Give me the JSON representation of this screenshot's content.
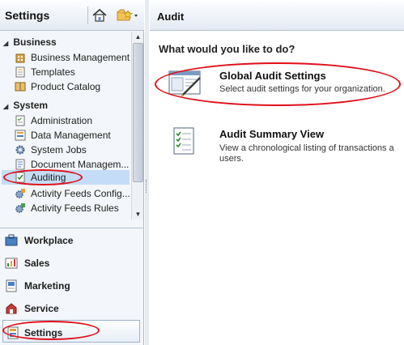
{
  "left_panel": {
    "title": "Settings",
    "home_icon": "home-icon",
    "favorites_icon": "star-folder-icon",
    "groups": [
      {
        "label": "Business",
        "items": [
          {
            "label": "Business Management",
            "icon": "building-icon"
          },
          {
            "label": "Templates",
            "icon": "templates-icon"
          },
          {
            "label": "Product Catalog",
            "icon": "catalog-icon"
          }
        ]
      },
      {
        "label": "System",
        "items": [
          {
            "label": "Administration",
            "icon": "administration-icon"
          },
          {
            "label": "Data Management",
            "icon": "data-management-icon"
          },
          {
            "label": "System Jobs",
            "icon": "gear-icon"
          },
          {
            "label": "Document Managem...",
            "icon": "document-management-icon"
          },
          {
            "label": "Auditing",
            "icon": "auditing-icon",
            "selected": true
          },
          {
            "label": "Activity Feeds Config...",
            "icon": "activity-feeds-config-icon"
          },
          {
            "label": "Activity Feeds Rules",
            "icon": "activity-feeds-rules-icon"
          }
        ]
      }
    ],
    "nav_buttons": [
      {
        "label": "Workplace",
        "icon": "workplace-icon"
      },
      {
        "label": "Sales",
        "icon": "sales-icon"
      },
      {
        "label": "Marketing",
        "icon": "marketing-icon"
      },
      {
        "label": "Service",
        "icon": "service-icon"
      },
      {
        "label": "Settings",
        "icon": "settings-icon",
        "active": true
      }
    ]
  },
  "main": {
    "title": "Audit",
    "prompt": "What would you like to do?",
    "options": [
      {
        "title": "Global Audit Settings",
        "description": "Select audit settings for your organization.",
        "icon": "global-audit-settings-icon"
      },
      {
        "title": "Audit Summary View",
        "description_line1": "View a chronological listing of transactions a",
        "description_line2": "users.",
        "icon": "audit-summary-view-icon"
      }
    ]
  },
  "colors": {
    "highlight_circle": "#e0101a",
    "selected_item_bg": "#c5dcf7",
    "header_border": "#b5c3d5"
  }
}
